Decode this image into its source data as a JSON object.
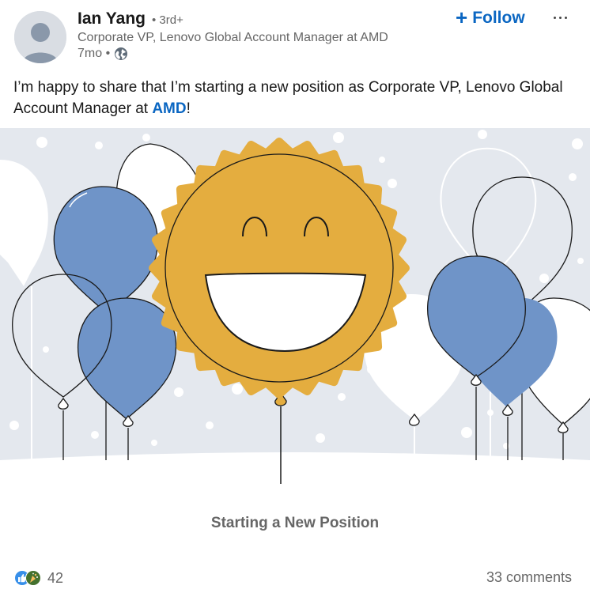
{
  "actor": {
    "name": "Ian Yang",
    "degree": "• 3rd+",
    "headline": "Corporate VP, Lenovo Global Account Manager at AMD",
    "time": "7mo •",
    "visibility_icon": "globe-icon"
  },
  "actions": {
    "follow_label": "Follow",
    "follow_icon": "+",
    "more_icon": "ellipsis-icon"
  },
  "post": {
    "text_before": "I’m happy to share that I’m starting a new position as Corporate VP, Lenovo Global Account Manager at ",
    "mention": "AMD",
    "text_after": "!"
  },
  "image": {
    "caption": "Starting a New Position",
    "colors": {
      "background": "#e4e8ee",
      "sun": "#e4ad3f",
      "balloon_blue": "#6f94c8",
      "balloon_white": "#ffffff",
      "outline": "#1a1a1a"
    }
  },
  "social": {
    "reaction_count": "42",
    "comments": "33 comments",
    "reaction_icons": [
      "like-icon",
      "celebrate-icon"
    ]
  },
  "colors": {
    "accent": "#0a66c2",
    "secondary_text": "#666666"
  }
}
